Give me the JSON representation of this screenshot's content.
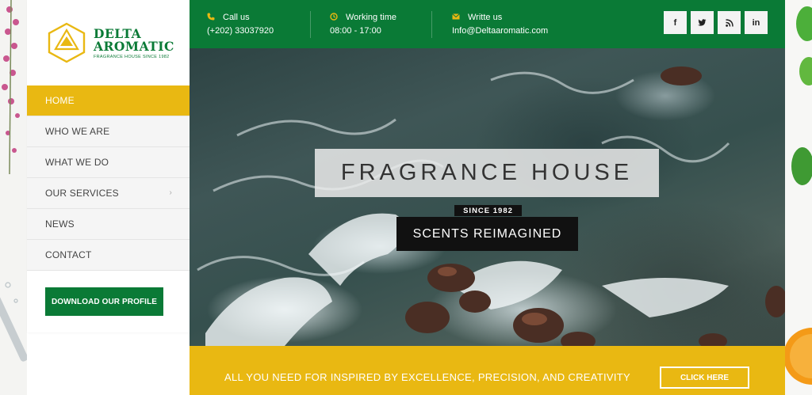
{
  "brand": {
    "name_line1": "DELTA",
    "name_line2": "AROMATIC",
    "tagline": "FRAGRANCE HOUSE SINCE 1982",
    "colors": {
      "green": "#0a7a36",
      "yellow": "#e9b812"
    }
  },
  "sidebar": {
    "items": [
      {
        "label": "HOME",
        "active": true
      },
      {
        "label": "WHO WE ARE",
        "active": false
      },
      {
        "label": "WHAT WE DO",
        "active": false
      },
      {
        "label": "OUR SERVICES",
        "active": false,
        "has_submenu": true
      },
      {
        "label": "NEWS",
        "active": false
      },
      {
        "label": "CONTACT",
        "active": false
      }
    ],
    "submenu_icon": "chevron-right-icon",
    "download_label": "DOWNLOAD OUR PROFILE"
  },
  "topbar": {
    "call": {
      "icon": "phone-icon",
      "label": "Call us",
      "value": "(+202) 33037920"
    },
    "hours": {
      "icon": "clock-icon",
      "label": "Working time",
      "value": "08:00 - 17:00"
    },
    "mail": {
      "icon": "envelope-icon",
      "label": "Writte us",
      "value": "Info@Deltaaromatic.com"
    },
    "social": [
      {
        "name": "facebook-icon",
        "glyph": "f"
      },
      {
        "name": "twitter-icon",
        "glyph": "🐦"
      },
      {
        "name": "rss-icon",
        "glyph": "rss"
      },
      {
        "name": "linkedin-icon",
        "glyph": "in"
      }
    ]
  },
  "hero": {
    "title": "FRAGRANCE HOUSE",
    "since": "SINCE 1982",
    "subtitle": "SCENTS REIMAGINED"
  },
  "band": {
    "text": "ALL YOU NEED FOR INSPIRED BY EXCELLENCE, PRECISION, AND CREATIVITY",
    "button_label": "CLICK HERE"
  }
}
